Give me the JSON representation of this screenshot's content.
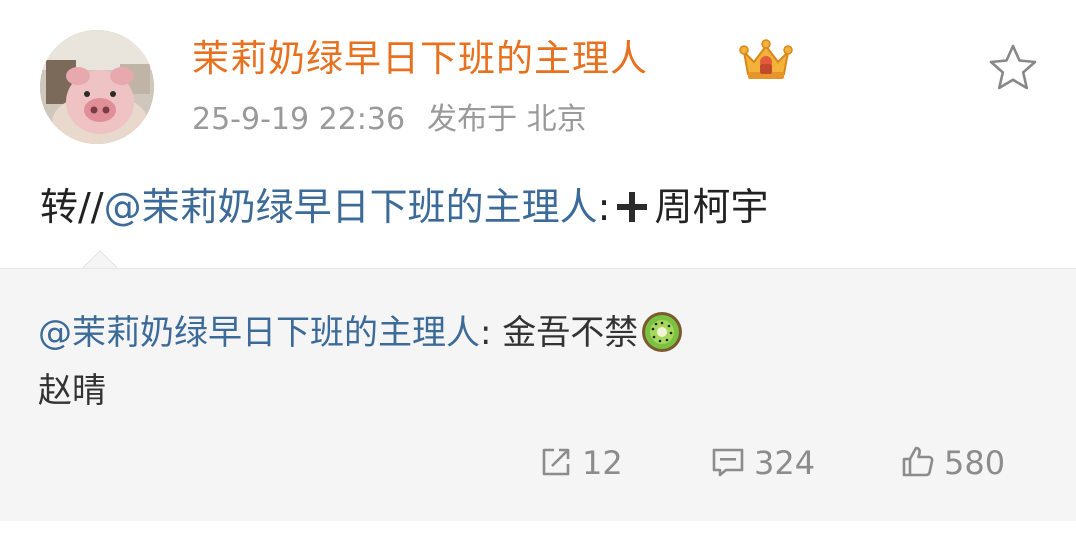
{
  "post": {
    "author": "茉莉奶绿早日下班的主理人",
    "timestamp": "25-9-19 22:36",
    "location": "发布于 北京",
    "badge_icon": "crown-badge-icon",
    "favorite_icon": "star-outline-icon"
  },
  "repost": {
    "prefix": "转//",
    "mention": "@茉莉奶绿早日下班的主理人",
    "separator": ":",
    "emoji_icon": "heavy-plus-icon",
    "text": "周柯宇"
  },
  "quoted": {
    "mention": "@茉莉奶绿早日下班的主理人",
    "separator": ": ",
    "text": "金吾不禁",
    "emoji_icon": "kiwi-icon",
    "line2": "赵晴"
  },
  "actions": {
    "repost_count": "12",
    "comment_count": "324",
    "like_count": "580"
  },
  "colors": {
    "author": "#e8711f",
    "mention": "#3d6b99",
    "meta": "#9a9a9a",
    "quote_bg": "#f5f5f5"
  }
}
